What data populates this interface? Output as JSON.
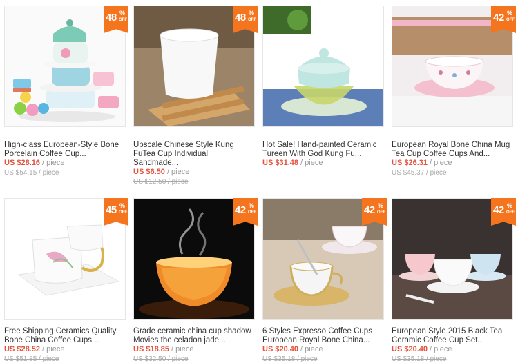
{
  "badge_off_label": "OFF",
  "badge_percent_sign": "%",
  "price_unit": "/ piece",
  "products": [
    {
      "title_line1": "High-class European-Style Bone",
      "title_line2": "Porcelain Coffee Cup...",
      "title_line3": "",
      "price": "US $28.16",
      "old_price": "US $54.15 / piece",
      "discount": "48"
    },
    {
      "title_line1": "Upscale Chinese Style Kung",
      "title_line2": "FuTea Cup Individual",
      "title_line3": "Sandmade...",
      "price": "US $6.50",
      "old_price": "US $12.50 / piece",
      "discount": "48"
    },
    {
      "title_line1": "Hot Sale! Hand-painted Ceramic",
      "title_line2": "Tureen With God Kung Fu...",
      "title_line3": "",
      "price": "US $31.48",
      "old_price": "",
      "discount": ""
    },
    {
      "title_line1": "European Royal Bone China Mug",
      "title_line2": "Tea Cup Coffee Cups And...",
      "title_line3": "",
      "price": "US $26.31",
      "old_price": "US $45.37 / piece",
      "discount": "42"
    },
    {
      "title_line1": "Free Shipping Ceramics Quality",
      "title_line2": "Bone China Coffee Cups...",
      "title_line3": "",
      "price": "US $28.52",
      "old_price": "US $51.85 / piece",
      "discount": "45"
    },
    {
      "title_line1": "Grade ceramic china cup shadow",
      "title_line2": "Movies the celadon jade...",
      "title_line3": "",
      "price": "US $18.85",
      "old_price": "US $32.50 / piece",
      "discount": "42"
    },
    {
      "title_line1": "6 Styles Expresso Coffee Cups",
      "title_line2": "European Royal Bone China...",
      "title_line3": "",
      "price": "US $20.40",
      "old_price": "US $35.18 / piece",
      "discount": "42"
    },
    {
      "title_line1": "European Style 2015 Black Tea",
      "title_line2": "Ceramic Coffee Cup Set...",
      "title_line3": "",
      "price": "US $20.40",
      "old_price": "US $35.18 / piece",
      "discount": "42"
    }
  ],
  "colors": {
    "badge": "#f5741e",
    "price": "#e4513d",
    "old_price": "#aaaaaa"
  }
}
